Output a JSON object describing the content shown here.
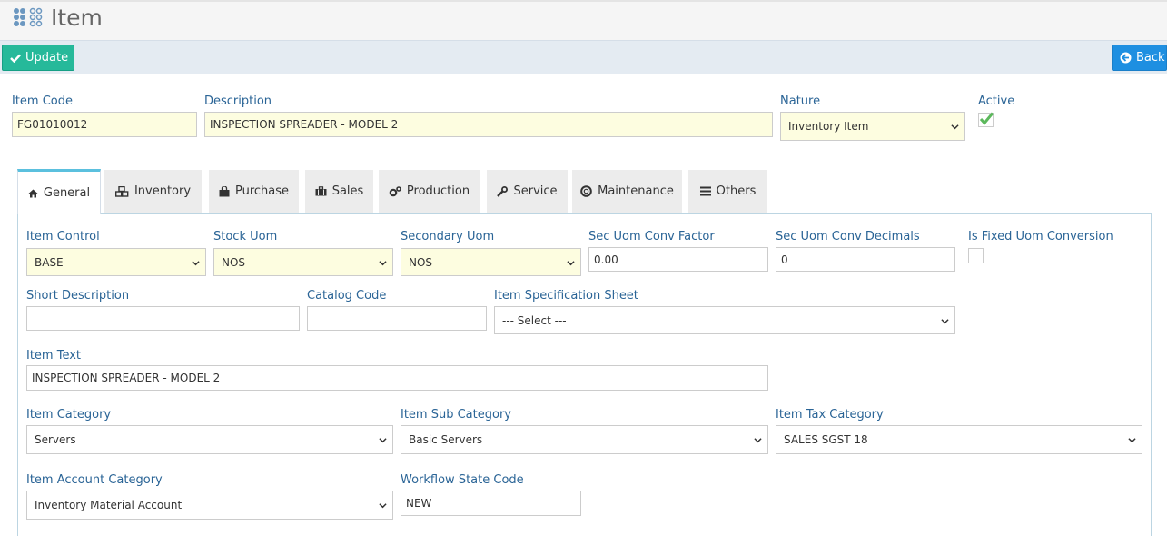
{
  "header": {
    "title": "Item"
  },
  "toolbar": {
    "update_label": "Update",
    "back_label": "Back"
  },
  "main": {
    "item_code": {
      "label": "Item Code",
      "value": "FG01010012"
    },
    "description": {
      "label": "Description",
      "value": "INSPECTION SPREADER - MODEL 2"
    },
    "nature": {
      "label": "Nature",
      "value": "Inventory Item"
    },
    "active": {
      "label": "Active",
      "checked": true
    }
  },
  "tabs": [
    {
      "label": "General",
      "icon": "home-icon",
      "active": true
    },
    {
      "label": "Inventory",
      "icon": "cubes-icon"
    },
    {
      "label": "Purchase",
      "icon": "shopping-bag-icon"
    },
    {
      "label": "Sales",
      "icon": "briefcase-icon"
    },
    {
      "label": "Production",
      "icon": "gears-icon"
    },
    {
      "label": "Service",
      "icon": "wrench-icon"
    },
    {
      "label": "Maintenance",
      "icon": "life-ring-icon"
    },
    {
      "label": "Others",
      "icon": "list-icon"
    }
  ],
  "general": {
    "item_control": {
      "label": "Item Control",
      "value": "BASE"
    },
    "stock_uom": {
      "label": "Stock Uom",
      "value": "NOS"
    },
    "secondary_uom": {
      "label": "Secondary Uom",
      "value": "NOS"
    },
    "sec_uom_conv_factor": {
      "label": "Sec Uom Conv Factor",
      "value": "0.00"
    },
    "sec_uom_conv_decimals": {
      "label": "Sec Uom Conv Decimals",
      "value": "0"
    },
    "is_fixed_uom_conversion": {
      "label": "Is Fixed Uom Conversion",
      "checked": false
    },
    "short_description": {
      "label": "Short Description",
      "value": ""
    },
    "catalog_code": {
      "label": "Catalog Code",
      "value": ""
    },
    "item_specification_sheet": {
      "label": "Item Specification Sheet",
      "value": "--- Select ---"
    },
    "item_text": {
      "label": "Item Text",
      "value": "INSPECTION SPREADER - MODEL 2"
    },
    "item_category": {
      "label": "Item Category",
      "value": "Servers"
    },
    "item_sub_category": {
      "label": "Item Sub Category",
      "value": "Basic Servers"
    },
    "item_tax_category": {
      "label": "Item Tax Category",
      "value": "SALES SGST 18"
    },
    "item_account_category": {
      "label": "Item Account Category",
      "value": "Inventory Material Account"
    },
    "workflow_state_code": {
      "label": "Workflow State Code",
      "value": "NEW"
    }
  },
  "colors": {
    "update_button": "#26b99a",
    "back_button": "#1e8fe1",
    "label_text": "#2a6496",
    "required_field_bg": "#fdfde0",
    "active_tab_border": "#5bc0de",
    "check_mark": "#5cb85c"
  }
}
